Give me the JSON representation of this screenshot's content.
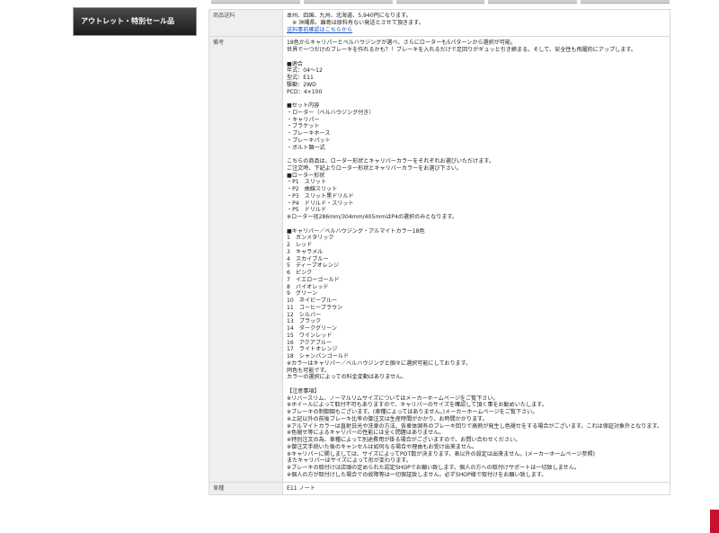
{
  "sidebar": {
    "outlet_banner_label": "アウトレット・特別セール品"
  },
  "table": {
    "rows": [
      {
        "label": "商品送料",
        "lines": "本州、四国、九州、北海道、5,940円になります。\n　※ 沖縄県、離島は原料有ない発送とさせて頂きます。"
      },
      {
        "label": "備考",
        "text": "18色からキャリパーとベルハウジングが選べ、さらにローターも5パターンから選択が可能。\n世界で一つだけのブレーキを作れるかも？！ブレーキを入れるだけで足回りがギュッと引き締まる。そして、安全性も飛躍的にアップします。\n\n■適合\n年式：04～12\n型式：E11\n駆動：2WD\nPCD：4×100\n\n■セット内容\n・ローター（ベルハウジング付き）\n・キャリパー\n・ブラケット\n・ブレーキホース\n・ブレーキパット\n・ボルト類一式\n\nこちらの商品は、ローター形状とキャリパーカラーをそれぞれお選びいただけます。\nご注文時、下記よりローター形状とキャリパーカラーをお選び下さい。\n■ローター形状\n・P1　スリット\n・P2　曲線スリット\n・P3　スリット黒ドリルド\n・P4　ドリルド・スリット\n・P5　ドリルド\n※ローター径286mm/304mm/405mmはP4の選択のみとなります。\n\n■キャリパー／ベルハウジング・アルマイトカラー18色\n1　ガンメタリック\n2　レッド\n3　キャラメル\n4　スカイブルー\n5　ディープオレンジ\n6　ピンク\n7　イエローゴールド\n8　バイオレッド\n9　グリーン\n10　ネイビーブルー\n11　コーヒーブラウン\n12　シルバー\n13　ブラック\n14　ダークグリーン\n15　ワインレッド\n16　アクアブルー\n17　ライトオレンジ\n18　シャンパンゴールド\n※カラーはキャリパー／ベルハウジングと個々に選択可能にしております。\n同色も可能です。\nカラーの選択によっての料金変動はありません。\n\n【注意事項】\n※リバースリム、ノーマルリムサイズについてはメーカーホームページをご覧下さい。\n※ホイールによって取付不可もありますので、キャリパーのサイズを確認して頂く事をお勧めいたします。\n※ブレーキの制御図もございます。(車種によってはありません。)メーカーホームページをご覧下さい。\n※上記以外の前後ブレーキ比率の御注文は生産時間がかかり、お時間かかります。\n※アルマイトカラーは直射日光や洗車の方法、各車体固有のブレーキ回りで高熱が発生し色褪せをする場合がございます。これは保証対象外となります。\n※色褪せ等によるキャリパーの性能には全く問題はありません。\n※特別注文の為、車種によって別途費用が掛る場合がございますので、お問い合わせください。\n※御注文手続いた後のキャンセルは如何なる場合や理由もお受け出来ません。\n※キャリパーに関しましては、サイズによってPOT数が決まります。表以外の設定は出来ません。(メーカーホームページ参照)\nまたキャリパーはサイズによって形が変わります。\n※ブレーキの取付けは店頭の定められた認定SHOPでお願い致します。個人の方への取付けサポートは一切致しません。\n※個人の方が取付けした場合での故障等は一切保証致しません。必ずSHOP様で取付けをお願い致します。"
      },
      {
        "label": "車種",
        "text": "E11 ノート"
      }
    ],
    "shipping_link": "送料事前確認はこちらから"
  },
  "colors": {
    "banner_bg": "#2a2a2a",
    "header_cell_bg": "#efefef",
    "link": "#1a53c9",
    "corner_accent": "#c8102e"
  }
}
